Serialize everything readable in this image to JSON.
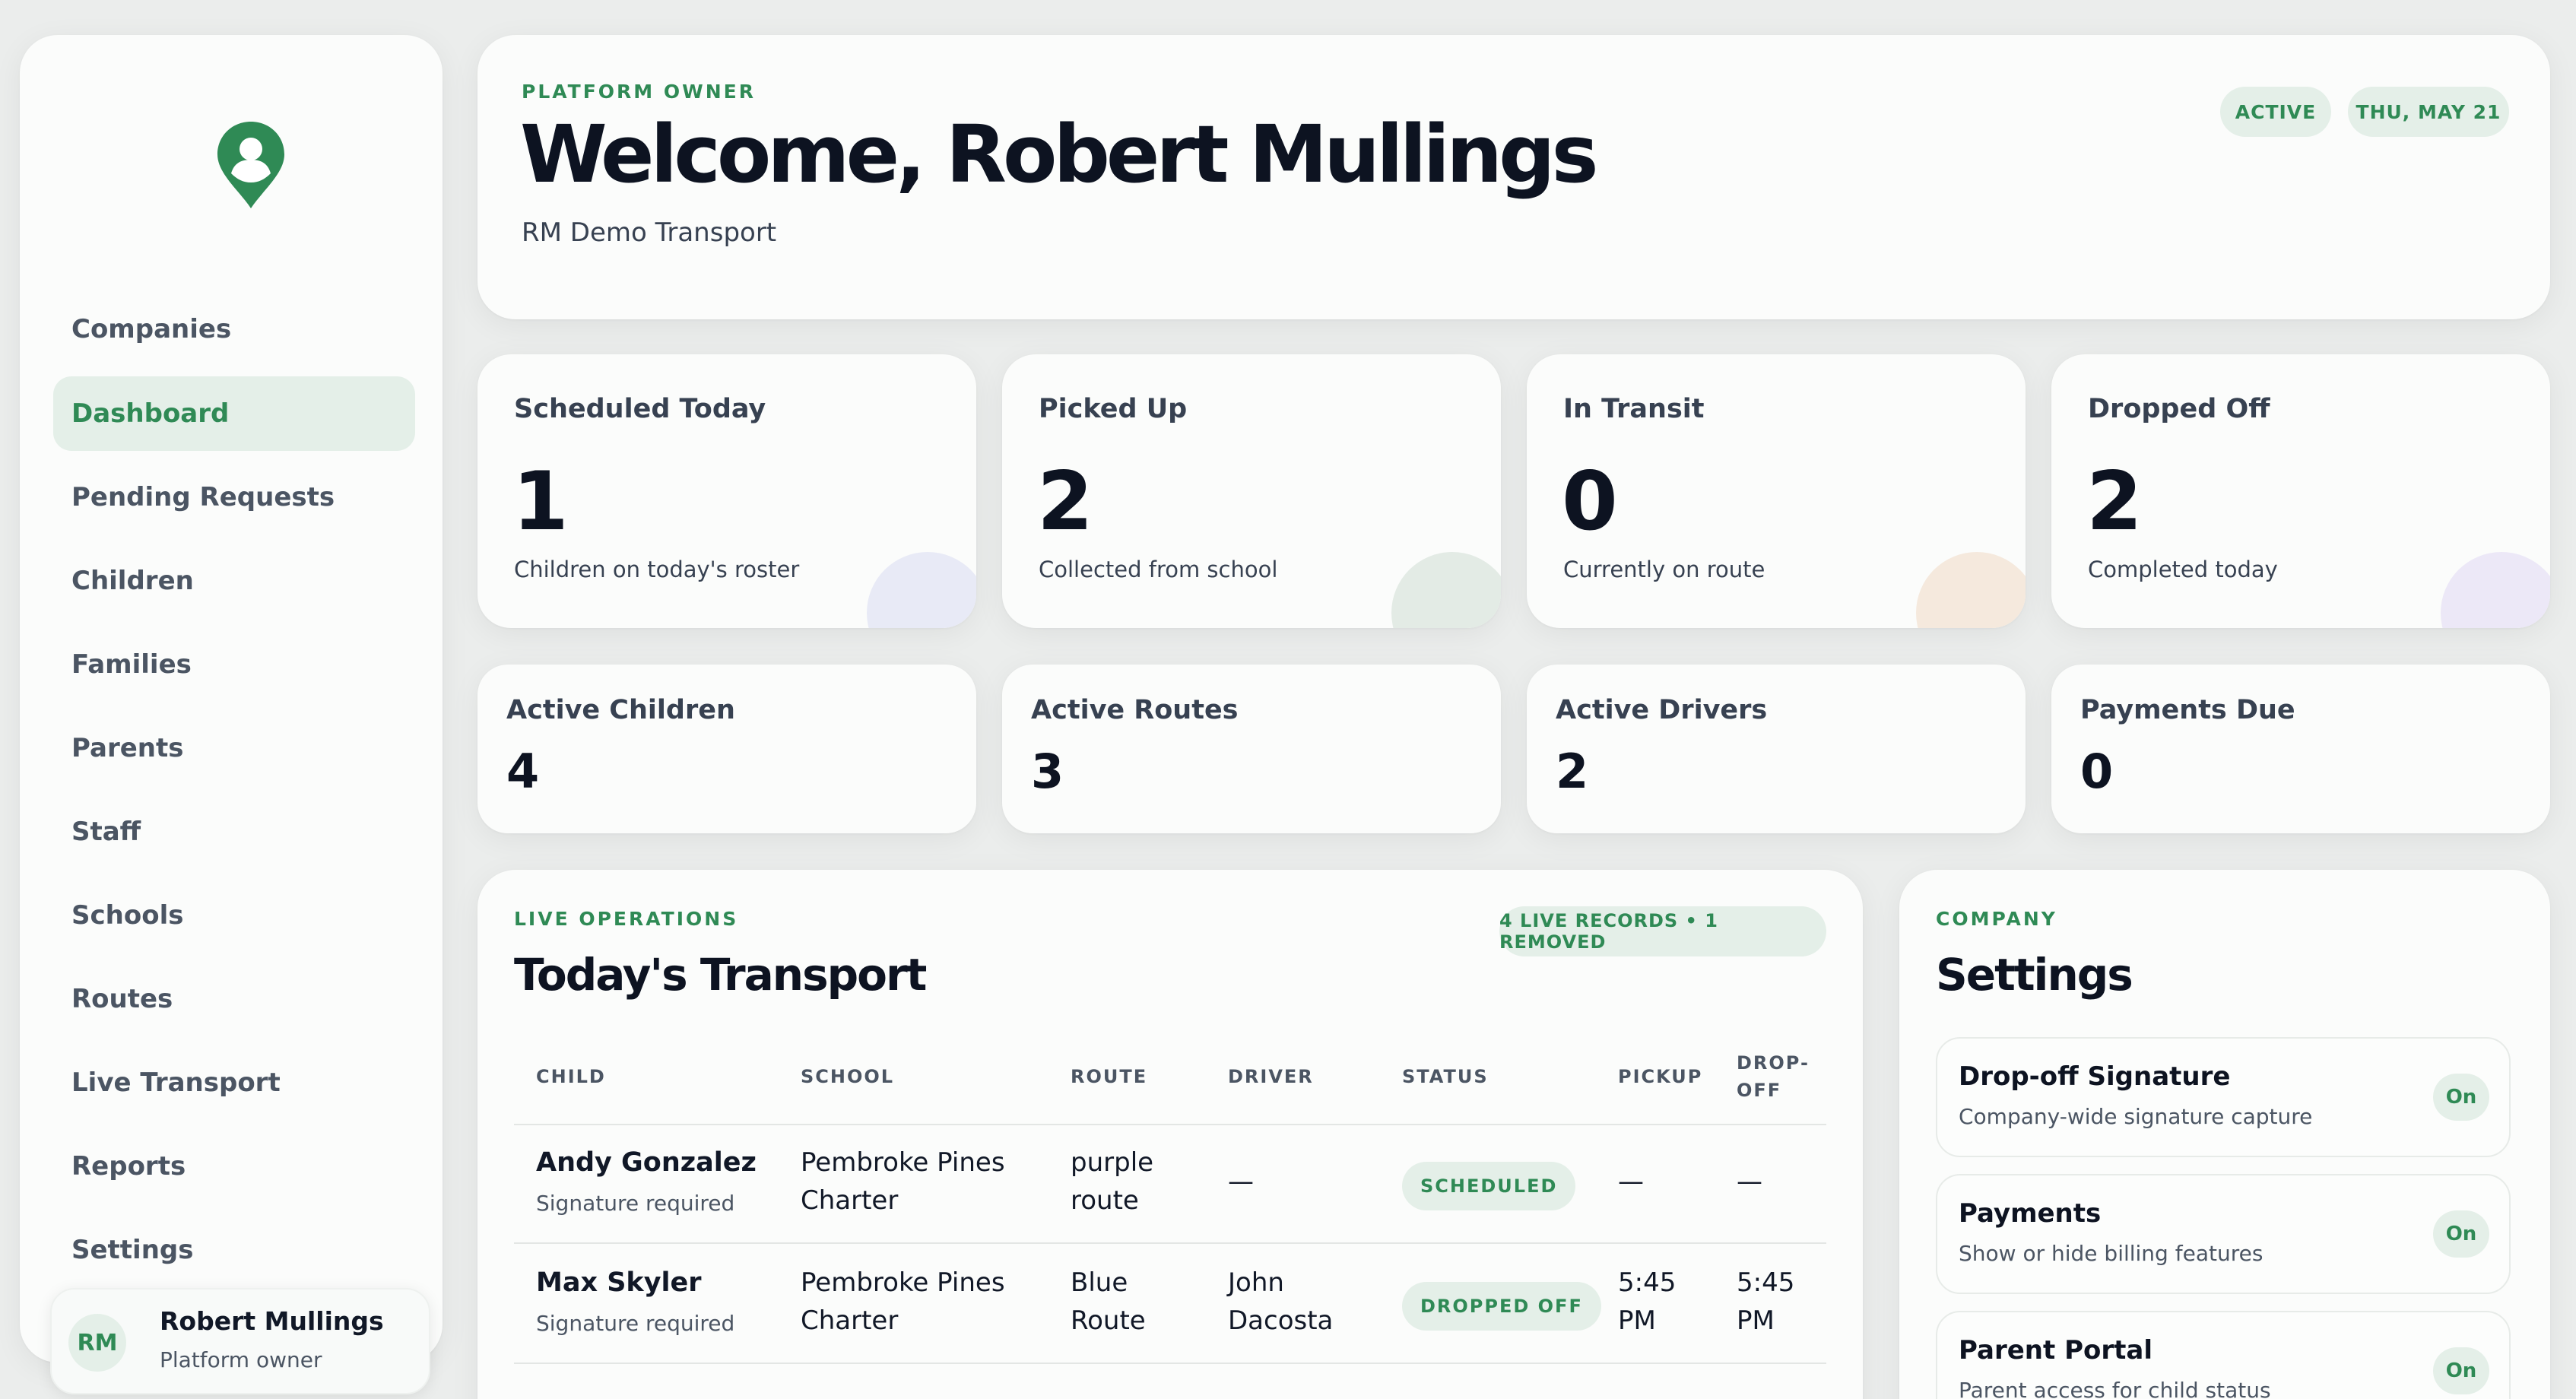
{
  "sidebar": {
    "logo_icon": "map-pin-person-icon",
    "items": [
      {
        "label": "Companies",
        "active": false
      },
      {
        "label": "Dashboard",
        "active": true
      },
      {
        "label": "Pending Requests",
        "active": false
      },
      {
        "label": "Children",
        "active": false
      },
      {
        "label": "Families",
        "active": false
      },
      {
        "label": "Parents",
        "active": false
      },
      {
        "label": "Staff",
        "active": false
      },
      {
        "label": "Schools",
        "active": false
      },
      {
        "label": "Routes",
        "active": false
      },
      {
        "label": "Live Transport",
        "active": false
      },
      {
        "label": "Reports",
        "active": false
      },
      {
        "label": "Settings",
        "active": false
      }
    ],
    "user": {
      "initials": "RM",
      "name": "Robert Mullings",
      "role": "Platform owner"
    }
  },
  "header": {
    "eyebrow": "PLATFORM OWNER",
    "title": "Welcome, Robert Mullings",
    "company": "RM Demo Transport",
    "status_pill": "ACTIVE",
    "date_pill": "THU, MAY 21"
  },
  "stats": [
    {
      "label": "Scheduled Today",
      "value": "1",
      "sub": "Children on today's roster"
    },
    {
      "label": "Picked Up",
      "value": "2",
      "sub": "Collected from school"
    },
    {
      "label": "In Transit",
      "value": "0",
      "sub": "Currently on route"
    },
    {
      "label": "Dropped Off",
      "value": "2",
      "sub": "Completed today"
    }
  ],
  "mini_stats": [
    {
      "label": "Active Children",
      "value": "4"
    },
    {
      "label": "Active Routes",
      "value": "3"
    },
    {
      "label": "Active Drivers",
      "value": "2"
    },
    {
      "label": "Payments Due",
      "value": "0"
    }
  ],
  "transport": {
    "eyebrow": "LIVE OPERATIONS",
    "title": "Today's Transport",
    "records_pill": "4 LIVE RECORDS • 1 REMOVED",
    "columns": {
      "child": "CHILD",
      "school": "SCHOOL",
      "route": "ROUTE",
      "driver": "DRIVER",
      "status": "STATUS",
      "pickup": "PICKUP",
      "dropoff_1": "DROP-",
      "dropoff_2": "OFF"
    },
    "rows": [
      {
        "child": "Andy Gonzalez",
        "note": "Signature required",
        "school_1": "Pembroke Pines",
        "school_2": "Charter",
        "route_1": "purple",
        "route_2": "route",
        "driver_1": "—",
        "driver_2": "",
        "status": "SCHEDULED",
        "pickup_1": "—",
        "pickup_2": "",
        "dropoff_1": "—",
        "dropoff_2": ""
      },
      {
        "child": "Max Skyler",
        "note": "Signature required",
        "school_1": "Pembroke Pines",
        "school_2": "Charter",
        "route_1": "Blue",
        "route_2": "Route",
        "driver_1": "John",
        "driver_2": "Dacosta",
        "status": "DROPPED OFF",
        "pickup_1": "5:45",
        "pickup_2": "PM",
        "dropoff_1": "5:45",
        "dropoff_2": "PM"
      }
    ]
  },
  "settings": {
    "eyebrow": "COMPANY",
    "title": "Settings",
    "items": [
      {
        "title": "Drop-off Signature",
        "desc": "Company-wide signature capture",
        "state": "On"
      },
      {
        "title": "Payments",
        "desc": "Show or hide billing features",
        "state": "On"
      },
      {
        "title": "Parent Portal",
        "desc": "Parent access for child status",
        "state": "On"
      }
    ]
  },
  "colors": {
    "accent": "#2f8a55",
    "accent_bg": "#e4efe8",
    "background": "#ebedec"
  }
}
